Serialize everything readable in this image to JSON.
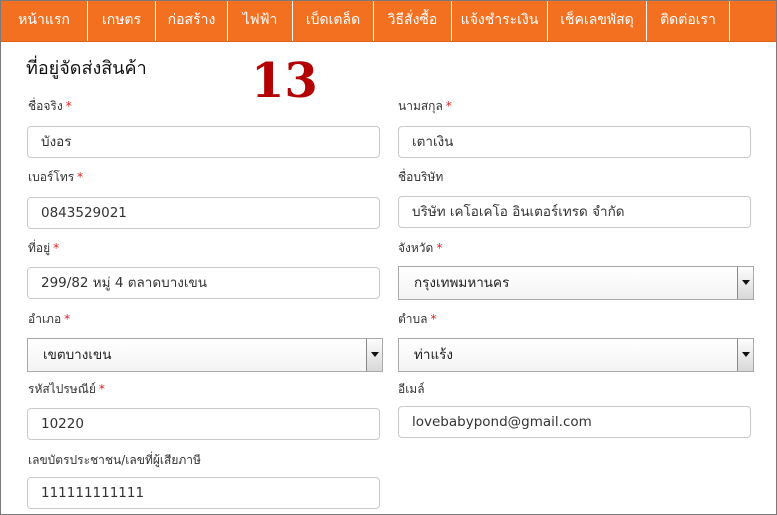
{
  "nav": {
    "items": [
      {
        "label": "หน้าแรก"
      },
      {
        "label": "เกษตร"
      },
      {
        "label": "ก่อสร้าง"
      },
      {
        "label": "ไฟฟ้า"
      },
      {
        "label": "เบ็ดเตล็ด"
      },
      {
        "label": "วิธีสั่งซื้อ"
      },
      {
        "label": "แจ้งชำระเงิน"
      },
      {
        "label": "เช็คเลขพัสดุ"
      },
      {
        "label": "ติดต่อเรา"
      }
    ],
    "bg_color": "#f37021"
  },
  "form": {
    "title": "ที่อยู่จัดส่งสินค้า",
    "step_number": "13",
    "required_mark": "*",
    "fields": {
      "first_name": {
        "label": "ชื่อจริง",
        "value": "บังอร"
      },
      "last_name": {
        "label": "นามสกุล",
        "value": "เตาเงิน"
      },
      "phone": {
        "label": "เบอร์โทร",
        "value": "0843529021"
      },
      "company": {
        "label": "ชื่อบริษัท",
        "value": "บริษัท เคโอเคโอ อินเตอร์เทรด จำกัด"
      },
      "address": {
        "label": "ที่อยู่",
        "value": "299/82 หมู่ 4 ตลาดบางเขน"
      },
      "province": {
        "label": "จังหวัด",
        "value": "กรุงเทพมหานคร"
      },
      "district": {
        "label": "อำเภอ",
        "value": "เขตบางเขน"
      },
      "subdistrict": {
        "label": "ตำบล",
        "value": "ท่าแร้ง"
      },
      "postcode": {
        "label": "รหัสไปรษณีย์",
        "value": "10220"
      },
      "email": {
        "label": "อีเมล์",
        "value": "lovebabypond@gmail.com"
      },
      "tax_id": {
        "label": "เลขบัตรประชาชน/เลขที่ผู้เสียภาษี",
        "value": "111111111111"
      }
    }
  }
}
